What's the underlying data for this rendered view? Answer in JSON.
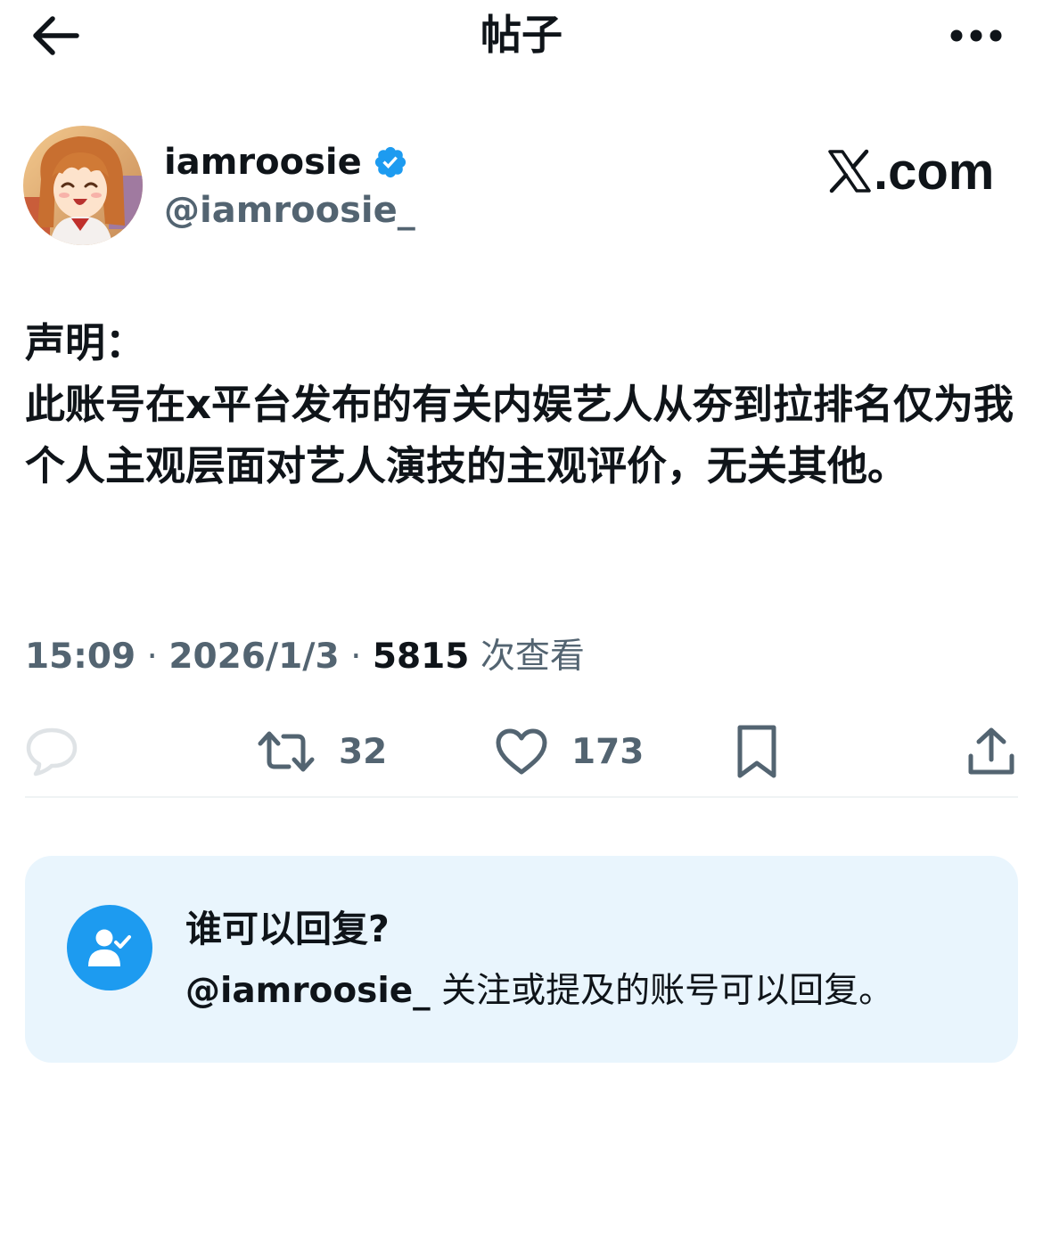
{
  "header": {
    "title": "帖子",
    "back_icon": "arrow-left-icon",
    "more_icon": "more-horizontal-icon"
  },
  "author": {
    "display_name": "iamroosie",
    "handle": "@iamroosie_",
    "verified": true,
    "verified_color": "#1d9bf0"
  },
  "brand": {
    "text": ".com"
  },
  "post": {
    "lines": [
      "声明：",
      "此账号在x平台发布的有关内娱艺人从夯到拉排名仅为我个人主观层面对艺人演技的主观评价，无关其他。"
    ],
    "time": "15:09",
    "date": "2026/1/3",
    "separator": " · ",
    "views_count": "5815",
    "views_label": "次查看"
  },
  "actions": {
    "reply_icon": "reply-bubble-icon",
    "retweet_count": "32",
    "like_count": "173",
    "bookmark_icon": "bookmark-icon",
    "share_icon": "share-icon"
  },
  "reply_restriction": {
    "title": "谁可以回复?",
    "handle": "@iamroosie_",
    "description": " 关注或提及的账号可以回复。",
    "icon": "user-check-icon",
    "background": "#e9f5fd",
    "icon_color": "#1d9bf0"
  }
}
